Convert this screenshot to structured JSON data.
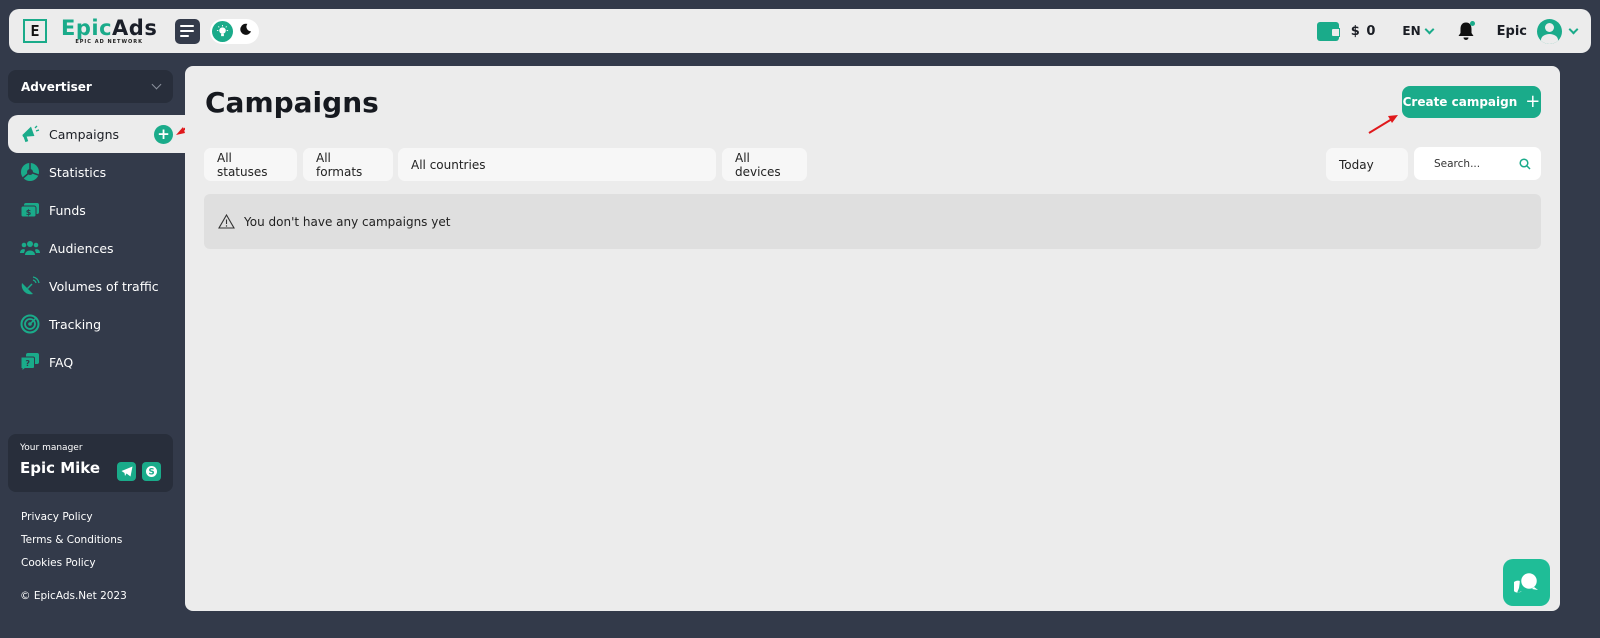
{
  "header": {
    "brand_first": "Epic",
    "brand_second": "Ads",
    "brand_tagline": "EPIC AD NETWORK",
    "logo_letter": "E",
    "balance": "$ 0",
    "language": "EN",
    "user_name": "Epic"
  },
  "sidebar": {
    "role": "Advertiser",
    "items": [
      {
        "label": "Campaigns",
        "icon": "megaphone-icon",
        "active": true
      },
      {
        "label": "Statistics",
        "icon": "pie-chart-icon"
      },
      {
        "label": "Funds",
        "icon": "money-icon"
      },
      {
        "label": "Audiences",
        "icon": "users-icon"
      },
      {
        "label": "Volumes of traffic",
        "icon": "satellite-dish-icon"
      },
      {
        "label": "Tracking",
        "icon": "radar-icon"
      },
      {
        "label": "FAQ",
        "icon": "question-chat-icon"
      }
    ],
    "manager": {
      "label": "Your manager",
      "name": "Epic Mike"
    },
    "footer_links": [
      "Privacy Policy",
      "Terms & Conditions",
      "Cookies Policy"
    ],
    "copyright": "© EpicAds.Net 2023"
  },
  "main": {
    "title": "Campaigns",
    "create_button": "Create campaign",
    "filters": {
      "status": "All statuses",
      "format": "All formats",
      "country": "All countries",
      "device": "All devices",
      "period": "Today"
    },
    "search_placeholder": "Search...",
    "empty_message": "You don't have any campaigns yet"
  },
  "colors": {
    "accent": "#1aab8a",
    "sidebar_bg": "#333a4a",
    "content_bg": "#ececec",
    "annotation_arrow": "#e0191c"
  }
}
